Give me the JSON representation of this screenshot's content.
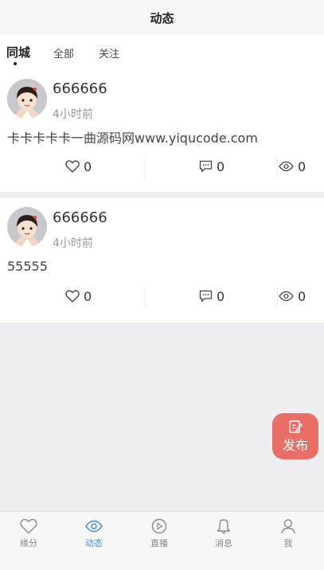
{
  "header": {
    "title": "动态"
  },
  "tabs": [
    {
      "label": "同城",
      "active": true
    },
    {
      "label": "全部",
      "active": false
    },
    {
      "label": "关注",
      "active": false
    }
  ],
  "posts": [
    {
      "username": "666666",
      "time": "4小时前",
      "content": "卡卡卡卡卡一曲源码网www.yiqucode.com",
      "likes": "0",
      "comments": "0",
      "views": "0"
    },
    {
      "username": "666666",
      "time": "4小时前",
      "content": "55555",
      "likes": "0",
      "comments": "0",
      "views": "0"
    }
  ],
  "fab": {
    "label": "发布"
  },
  "tabbar": [
    {
      "label": "缘分",
      "icon": "heart-icon",
      "active": false
    },
    {
      "label": "动态",
      "icon": "eye-icon",
      "active": true
    },
    {
      "label": "直播",
      "icon": "play-icon",
      "active": false
    },
    {
      "label": "消息",
      "icon": "bell-icon",
      "active": false
    },
    {
      "label": "我",
      "icon": "user-icon",
      "active": false
    }
  ],
  "colors": {
    "accent": "#4a8cd8",
    "fab": "#e86e66",
    "background": "#eeedf2"
  }
}
